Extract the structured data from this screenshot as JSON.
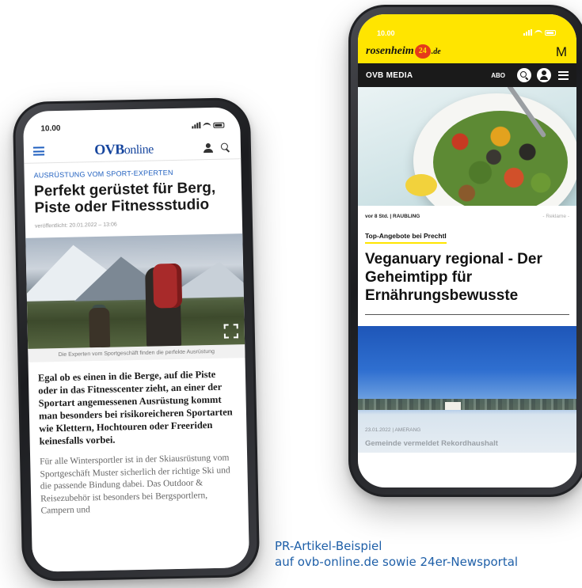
{
  "left_phone": {
    "status_time": "10.00",
    "brand": {
      "bold": "OVB",
      "light": "online"
    },
    "kicker": "AUSRÜSTUNG VOM SPORT-EXPERTEN",
    "headline": "Perfekt gerüstet für Berg, Piste oder Fitnessstudio",
    "published": "veröffentlicht: 20.01.2022 – 13:06",
    "image_caption": "Die Experten vom Sportgeschäft finden die perfekte Ausrüstung",
    "lead": "Egal ob es einen in die Berge, auf die Piste oder in das Fitnesscenter zieht, an einer der Sportart angemessenen Ausrüstung kommt man besonders bei risikoreicheren Sportarten wie Klettern, Hochtouren oder Freeriden keinesfalls vorbei.",
    "body": "Für alle Wintersportler ist in der Skiausrüstung vom Sportgeschäft Muster sicherlich der richtige Ski und die passende Bindung dabei. Das Outdoor & Reisezubehör ist besonders bei Bergsportlern, Campern und"
  },
  "right_phone": {
    "status_time": "10.00",
    "brand": {
      "name": "rosenheim",
      "number": "24",
      "suffix": ".de"
    },
    "menu_letter": "M",
    "media_label": "OVB MEDIA",
    "abo_label": "ABO",
    "article": {
      "meta_location": "vor 8 Std. | RAUBLING",
      "ad_label": "- Reklame -",
      "sponsor": "Top-Angebote bei Prechtl",
      "headline": "Veganuary regional - Der Geheimtipp für Ernährungsbewusste"
    },
    "second_article": {
      "date": "23.01.2022 | AMERANG",
      "teaser": "Gemeinde vermeldet Rekordhaushalt"
    }
  },
  "caption": {
    "line1": "PR-Artikel-Beispiel",
    "line2": "auf ovb-online.de sowie 24er-Newsportal"
  },
  "colors": {
    "ovb_blue": "#17469e",
    "accent_yellow": "#ffe500",
    "caption_blue": "#1e5fa8"
  }
}
